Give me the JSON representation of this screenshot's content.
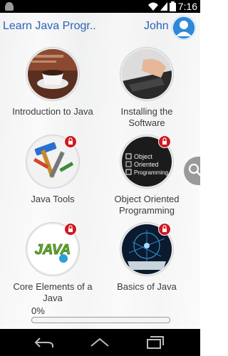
{
  "status": {
    "time": "7:16"
  },
  "header": {
    "title": "Learn Java Progr...",
    "user_name": "John"
  },
  "courses": [
    {
      "label": "Introduction to Java",
      "image": "coffee-cup",
      "locked": false
    },
    {
      "label": "Installing the Software",
      "image": "hand-on-keyboard",
      "locked": false
    },
    {
      "label": "Java Tools",
      "image": "tools",
      "locked": true
    },
    {
      "label": "Object Oriented Programming",
      "image": "blackboard-checklist",
      "locked": true
    },
    {
      "label": "Core Elements of a Java",
      "image": "java-logo",
      "locked": true
    },
    {
      "label": "Basics of Java",
      "image": "digital-network",
      "locked": true
    }
  ],
  "blackboard": {
    "line1": "Object",
    "line2": "Oriented",
    "line3": "Programming"
  },
  "java_logo_text": "JAVA",
  "progress": {
    "label": "0%",
    "value": 0
  },
  "colors": {
    "accent": "#2a63b8",
    "lock": "#d01820"
  }
}
